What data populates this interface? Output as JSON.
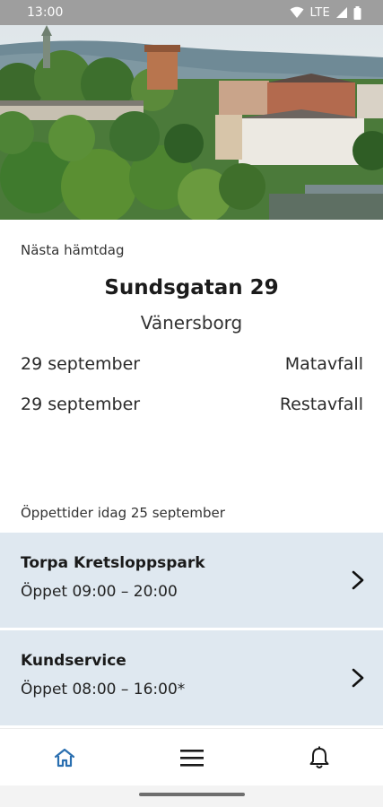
{
  "status_bar": {
    "time": "13:00",
    "network": "LTE"
  },
  "hero": {
    "image": "city-view-photo"
  },
  "next_pickup": {
    "label": "Nästa hämtdag",
    "street": "Sundsgatan 29",
    "city": "Vänersborg",
    "items": [
      {
        "date": "29 september",
        "type": "Matavfall"
      },
      {
        "date": "29 september",
        "type": "Restavfall"
      }
    ]
  },
  "opening_hours": {
    "label": "Öppettider idag 25 september",
    "places": [
      {
        "name": "Torpa Kretsloppspark",
        "hours": "Öppet 09:00 – 20:00"
      },
      {
        "name": "Kundservice",
        "hours": "Öppet 08:00 – 16:00*"
      }
    ]
  },
  "bottom_nav": {
    "items": [
      {
        "icon": "home-icon",
        "active": true
      },
      {
        "icon": "menu-icon",
        "active": false
      },
      {
        "icon": "bell-icon",
        "active": false
      }
    ]
  },
  "colors": {
    "accent": "#2a6fb0",
    "card_bg": "#dfe8f0",
    "status_bar": "#9e9e9e"
  }
}
